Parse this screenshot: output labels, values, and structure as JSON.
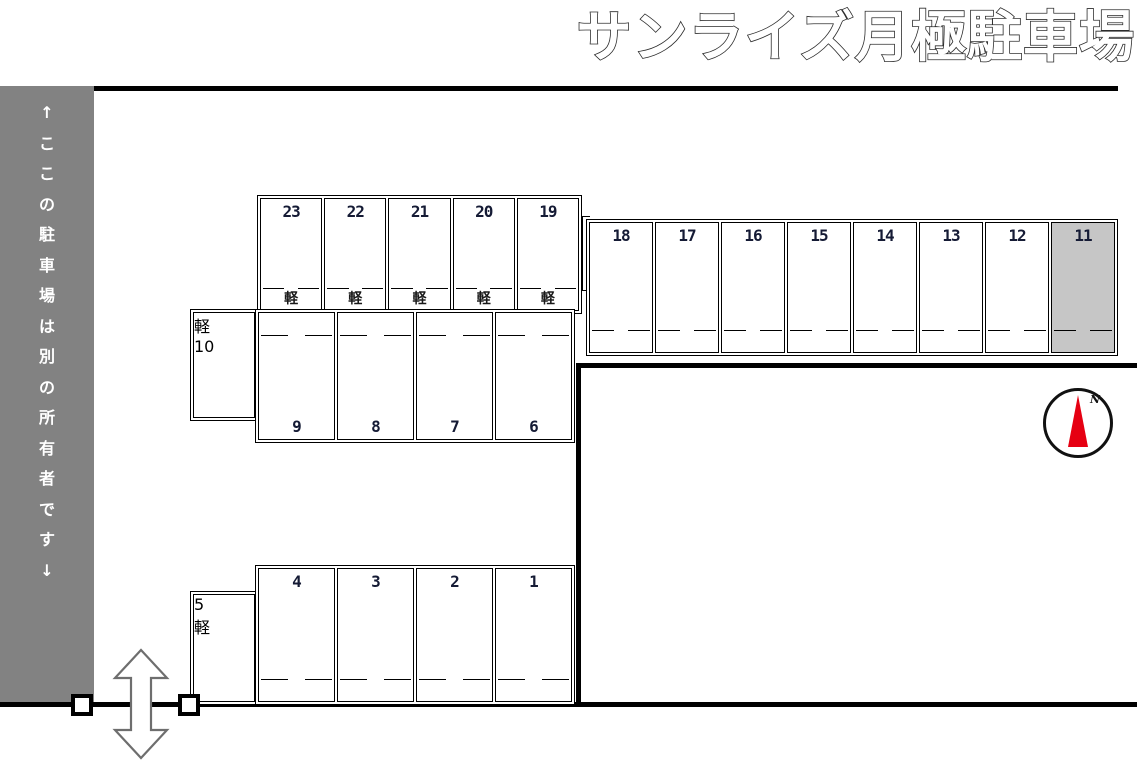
{
  "header": {
    "title": "サンライズ月極駐車場"
  },
  "owner_note": {
    "text": "↑ここの駐車場は別の所有者です↓",
    "chars": [
      "↑",
      "こ",
      "こ",
      "の",
      "駐",
      "車",
      "場",
      "は",
      "別",
      "の",
      "所",
      "有",
      "者",
      "で",
      "す",
      "↓"
    ],
    "background_color": "#828282",
    "text_color": "#ffffff"
  },
  "legend": {
    "kei_label": "軽",
    "occupied_color": "#c6c6c6",
    "available_color": "#ffffff",
    "number_color": "#151b35"
  },
  "compass": {
    "north_label": "N",
    "needle_color": "#e60012",
    "ring_color": "#111111"
  },
  "entrance": {
    "name": "entrance-exit",
    "arrow": "double-headed-vertical"
  },
  "rows": {
    "top": {
      "name": "row-19-23",
      "stalls": [
        {
          "number": "23",
          "kei": "軽",
          "occupied": false
        },
        {
          "number": "22",
          "kei": "軽",
          "occupied": false
        },
        {
          "number": "21",
          "kei": "軽",
          "occupied": false
        },
        {
          "number": "20",
          "kei": "軽",
          "occupied": false
        },
        {
          "number": "19",
          "kei": "軽",
          "occupied": false
        }
      ]
    },
    "right": {
      "name": "row-11-18",
      "stalls": [
        {
          "number": "18",
          "kei": "",
          "occupied": false
        },
        {
          "number": "17",
          "kei": "",
          "occupied": false
        },
        {
          "number": "16",
          "kei": "",
          "occupied": false
        },
        {
          "number": "15",
          "kei": "",
          "occupied": false
        },
        {
          "number": "14",
          "kei": "",
          "occupied": false
        },
        {
          "number": "13",
          "kei": "",
          "occupied": false
        },
        {
          "number": "12",
          "kei": "",
          "occupied": false
        },
        {
          "number": "11",
          "kei": "",
          "occupied": true
        }
      ]
    },
    "middle": {
      "name": "row-6-9",
      "stalls": [
        {
          "number": "9",
          "kei": "",
          "occupied": false
        },
        {
          "number": "8",
          "kei": "",
          "occupied": false
        },
        {
          "number": "7",
          "kei": "",
          "occupied": false
        },
        {
          "number": "6",
          "kei": "",
          "occupied": false
        }
      ]
    },
    "bottom": {
      "name": "row-1-4",
      "stalls": [
        {
          "number": "4",
          "kei": "",
          "occupied": false
        },
        {
          "number": "3",
          "kei": "",
          "occupied": false
        },
        {
          "number": "2",
          "kei": "",
          "occupied": false
        },
        {
          "number": "1",
          "kei": "",
          "occupied": false
        }
      ]
    },
    "single_10": {
      "number": "10",
      "kei": "軽",
      "occupied": false
    },
    "single_5": {
      "number": "5",
      "kei": "軽",
      "occupied": false
    }
  }
}
